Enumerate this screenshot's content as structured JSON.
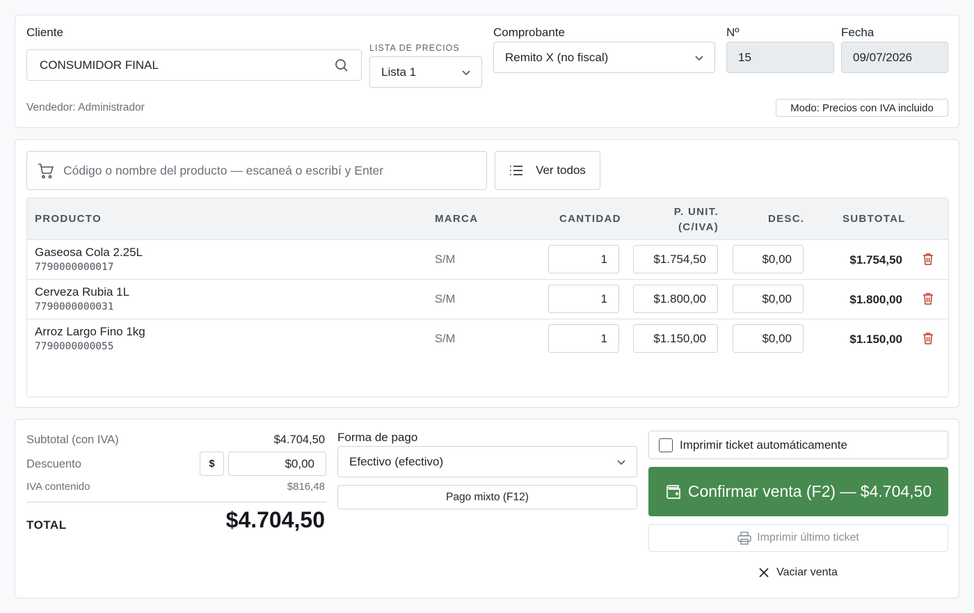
{
  "colors": {
    "accent_green": "#478a4f",
    "danger_red": "#c0392b",
    "border": "#cfd4da",
    "muted_text": "#6a7079"
  },
  "header": {
    "cliente_label": "Cliente",
    "cliente_value": "CONSUMIDOR FINAL",
    "lista_label": "LISTA DE PRECIOS",
    "lista_value": "Lista 1",
    "comprobante_label": "Comprobante",
    "comprobante_value": "Remito X (no fiscal)",
    "numero_label": "Nº",
    "numero_value": "15",
    "fecha_label": "Fecha",
    "fecha_value": "09/07/2026",
    "vendedor": "Vendedor: Administrador",
    "modo_badge": "Modo: Precios con IVA incluido"
  },
  "products": {
    "search_placeholder": "Código o nombre del producto — escaneá o escribí y Enter",
    "ver_todos_label": "Ver todos",
    "columns": {
      "producto": "PRODUCTO",
      "marca": "MARCA",
      "cantidad": "CANTIDAD",
      "punit_line1": "P. UNIT.",
      "punit_line2": "(C/IVA)",
      "desc": "DESC.",
      "subtotal": "SUBTOTAL"
    },
    "rows": [
      {
        "name": "Gaseosa Cola 2.25L",
        "code": "7790000000017",
        "marca": "S/M",
        "cantidad": "1",
        "precio": "$1.754,50",
        "desc": "$0,00",
        "subtotal": "$1.754,50"
      },
      {
        "name": "Cerveza Rubia 1L",
        "code": "7790000000031",
        "marca": "S/M",
        "cantidad": "1",
        "precio": "$1.800,00",
        "desc": "$0,00",
        "subtotal": "$1.800,00"
      },
      {
        "name": "Arroz Largo Fino 1kg",
        "code": "7790000000055",
        "marca": "S/M",
        "cantidad": "1",
        "precio": "$1.150,00",
        "desc": "$0,00",
        "subtotal": "$1.150,00"
      }
    ]
  },
  "totals": {
    "subtotal_label": "Subtotal (con IVA)",
    "subtotal_value": "$4.704,50",
    "descuento_label": "Descuento",
    "descuento_type": "$",
    "descuento_value": "$0,00",
    "iva_label": "IVA contenido",
    "iva_value": "$816,48",
    "total_label": "TOTAL",
    "total_value": "$4.704,50"
  },
  "payment": {
    "forma_label": "Forma de pago",
    "forma_value": "Efectivo (efectivo)",
    "pago_mixto_label": "Pago mixto (F12)"
  },
  "actions": {
    "imprimir_auto_label": "Imprimir ticket automáticamente",
    "confirmar_label": "Confirmar venta (F2) — $4.704,50",
    "imprimir_ultimo_label": "Imprimir último ticket",
    "vaciar_label": "Vaciar venta"
  }
}
